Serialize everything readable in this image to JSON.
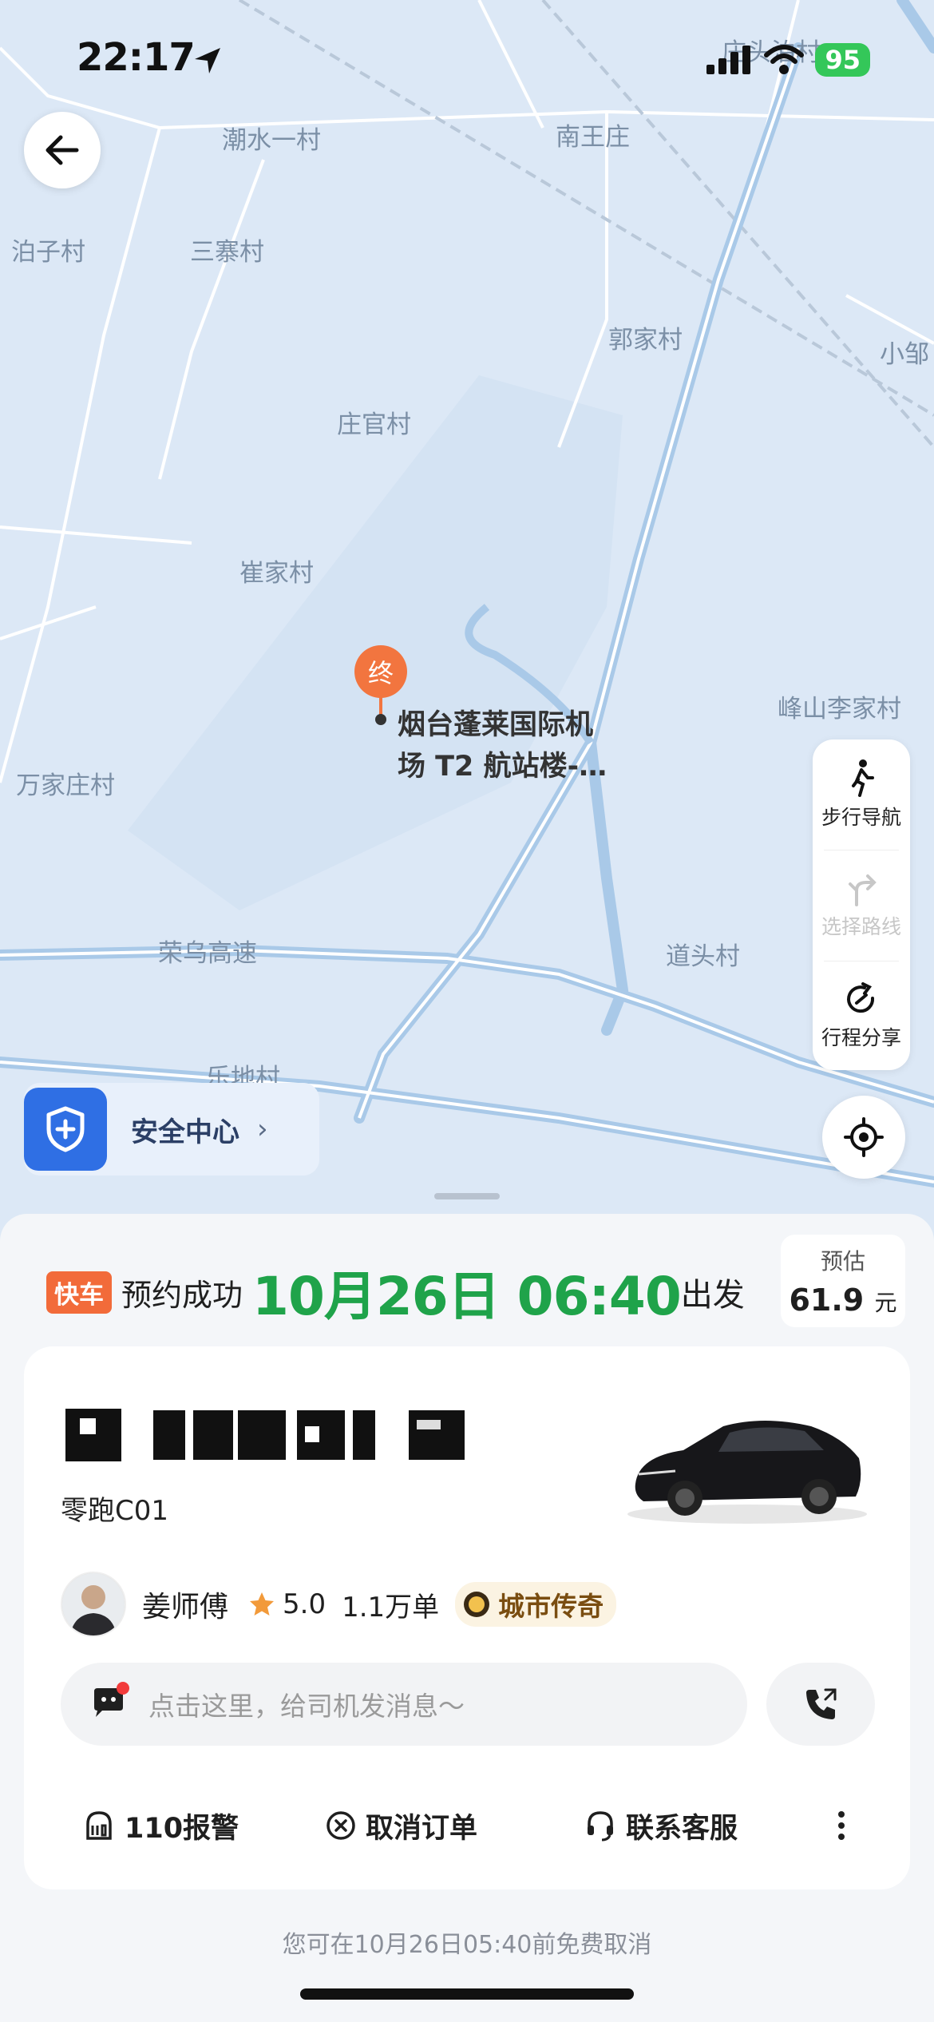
{
  "status_bar": {
    "time": "22:17",
    "battery": "95"
  },
  "map": {
    "places": [
      "潮水一村",
      "南王庄",
      "泊子村",
      "三寨村",
      "郭家村",
      "小邹",
      "庄官村",
      "崔家村",
      "峰山李家村",
      "万家庄村",
      "荣乌高速",
      "道头村",
      "乐地村",
      "庄头泊村"
    ],
    "destination_marker": "终",
    "destination_label_line1": "烟台蓬莱国际机",
    "destination_label_line2": "场 T2 航站楼-…"
  },
  "side_panel": {
    "walk_nav": "步行导航",
    "choose_route": "选择路线",
    "trip_share": "行程分享"
  },
  "safety_center": {
    "label": "安全中心"
  },
  "order": {
    "tag": "快车",
    "status": "预约成功",
    "datetime": "10月26日 06:40",
    "depart": "出发",
    "estimate_label": "预估",
    "estimate_value": "61.9",
    "estimate_unit": "元"
  },
  "driver": {
    "car_model": "零跑C01",
    "name": "姜师傅",
    "rating": "5.0",
    "orders": "1.1万单",
    "title": "城市传奇",
    "message_placeholder": "点击这里，给司机发消息～"
  },
  "actions": {
    "police": "110报警",
    "cancel": "取消订单",
    "service": "联系客服"
  },
  "cancel_note": "您可在10月26日05:40前免费取消"
}
